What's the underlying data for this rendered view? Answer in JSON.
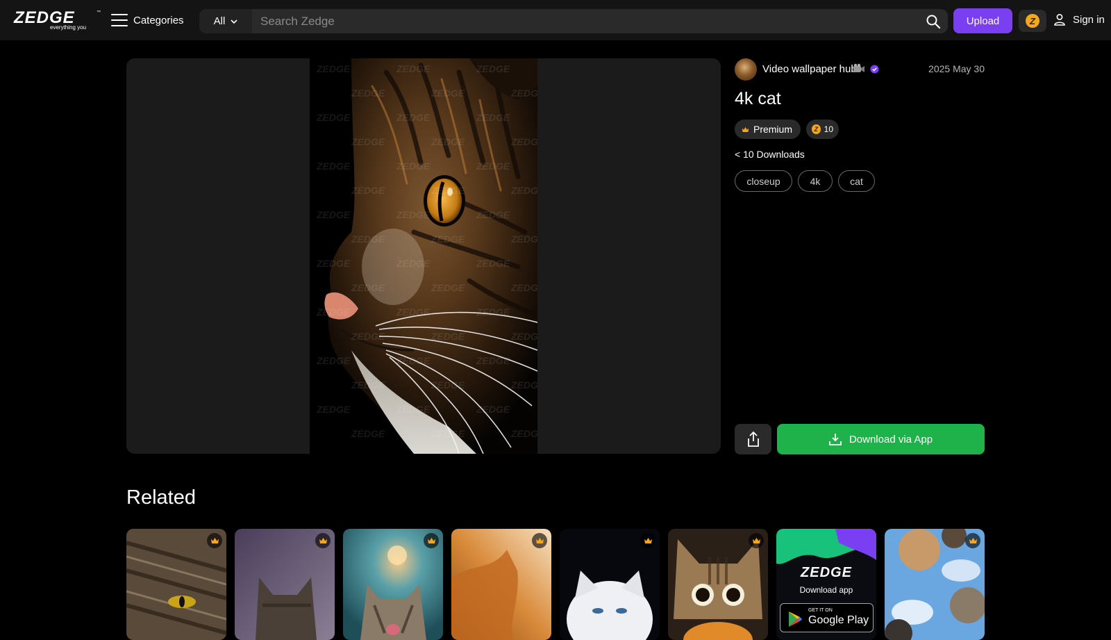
{
  "header": {
    "logo": {
      "word": "ZEDGE",
      "tagline": "everything you",
      "tm": "™"
    },
    "categories_label": "Categories",
    "search": {
      "scope": "All",
      "placeholder": "Search Zedge"
    },
    "upload_label": "Upload",
    "coin_glyph": "Z",
    "signin_label": "Sign in"
  },
  "preview": {
    "watermark_text": "ZEDGE"
  },
  "item": {
    "author": "Video wallpaper hub",
    "author_emoji": "camera-icon",
    "verified": true,
    "date": "2025 May 30",
    "title": "4k cat",
    "premium_label": "Premium",
    "price": "10",
    "downloads": "< 10 Downloads",
    "tags": [
      "closeup",
      "4k",
      "cat"
    ],
    "download_label": "Download via App"
  },
  "related": {
    "title": "Related",
    "promo": {
      "logo": "ZEDGE",
      "subtitle": "Download app",
      "store_small": "GET IT ON",
      "store_big": "Google Play"
    }
  },
  "colors": {
    "accent_purple": "#7b3ff2",
    "download_green": "#1fb14a",
    "coin_gold": "#f5a81c"
  }
}
